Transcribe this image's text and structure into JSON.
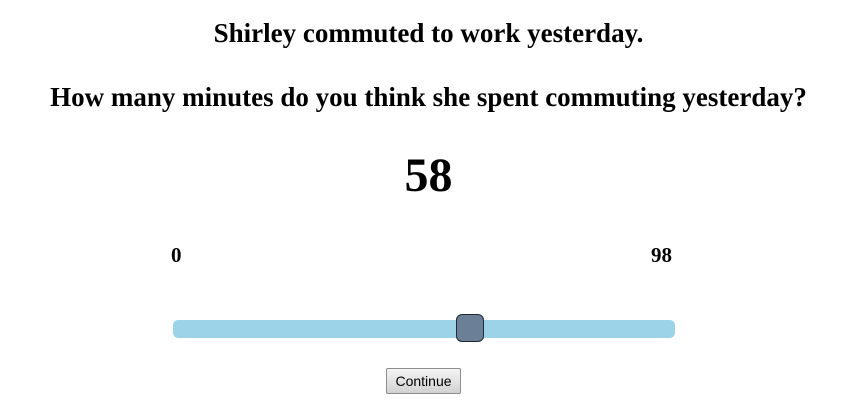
{
  "prompt": {
    "statement": "Shirley commuted to work yesterday.",
    "question": "How many minutes do you think she spent commuting yesterday?"
  },
  "slider": {
    "value": "58",
    "min": "0",
    "max": "98",
    "track_color": "#9dd3e8",
    "thumb_color": "#6b7f96"
  },
  "actions": {
    "continue_label": "Continue"
  }
}
